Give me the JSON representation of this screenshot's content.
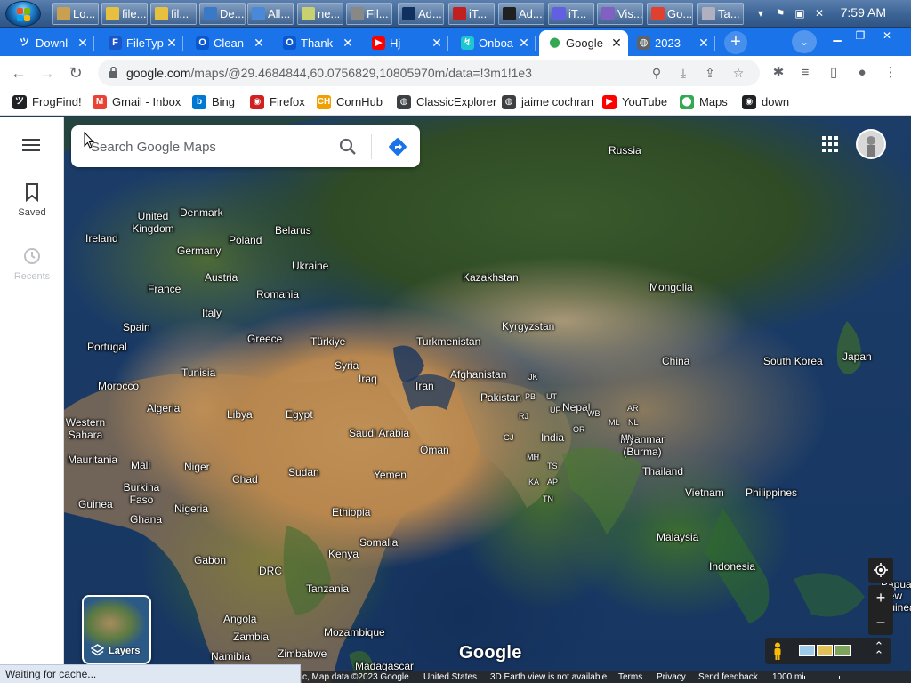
{
  "taskbar": {
    "tasks": [
      {
        "label": "Lo...",
        "color": "#c8a050"
      },
      {
        "label": "file...",
        "color": "#e8c040"
      },
      {
        "label": "fil...",
        "color": "#e8c040"
      },
      {
        "label": "De...",
        "color": "#3a78c8"
      },
      {
        "label": "All...",
        "color": "#4a88d8"
      },
      {
        "label": "ne...",
        "color": "#c8d070"
      },
      {
        "label": "Fil...",
        "color": "#888888"
      },
      {
        "label": "Ad...",
        "color": "#103060"
      },
      {
        "label": "iT...",
        "color": "#c02020"
      },
      {
        "label": "Ad...",
        "color": "#202020"
      },
      {
        "label": "iT...",
        "color": "#6060e0"
      },
      {
        "label": "Vis...",
        "color": "#8060c0"
      },
      {
        "label": "Go...",
        "color": "#e04030"
      },
      {
        "label": "Ta...",
        "color": "#b0b0c0"
      }
    ],
    "clock": "7:59 AM"
  },
  "browser": {
    "tabs": [
      {
        "label": "Downl",
        "icon": "frogfind-icon",
        "color": "#1a73e8",
        "active": false
      },
      {
        "label": "FileTyp",
        "icon": "filetype-icon",
        "color": "#1a56c8",
        "active": false
      },
      {
        "label": "Clean",
        "icon": "clean-icon",
        "color": "#0b57d0",
        "active": false
      },
      {
        "label": "Thank",
        "icon": "thank-icon",
        "color": "#0b57d0",
        "active": false
      },
      {
        "label": "Hj",
        "icon": "youtube-icon",
        "color": "#ff0000",
        "active": false
      },
      {
        "label": "Onboa",
        "icon": "onboard-icon",
        "color": "#1cc7d0",
        "active": false
      },
      {
        "label": "Google",
        "icon": "maps-pin-icon",
        "color": "#34a853",
        "active": true
      },
      {
        "label": "2023",
        "icon": "globe-icon",
        "color": "#5f6368",
        "active": false
      }
    ],
    "url_host": "google.com",
    "url_path": "/maps/@29.4684844,60.0756829,10805970m/data=!3m1!1e3"
  },
  "bookmarks": [
    {
      "label": "FrogFind!",
      "color": "#202124",
      "icon": "frogfind-icon"
    },
    {
      "label": "Gmail - Inbox",
      "color": "#ea4335",
      "icon": "gmail-icon"
    },
    {
      "label": "Bing",
      "color": "#0078d4",
      "icon": "bing-icon"
    },
    {
      "label": "Firefox",
      "color": "#d02020",
      "icon": "firefox-icon"
    },
    {
      "label": "CornHub",
      "color": "#f0a000",
      "icon": "cornhub-icon"
    },
    {
      "label": "ClassicExplorer",
      "color": "#3c4043",
      "icon": "globe-icon"
    },
    {
      "label": "jaime cochran",
      "color": "#3c4043",
      "icon": "globe-icon"
    },
    {
      "label": "YouTube",
      "color": "#ff0000",
      "icon": "youtube-icon"
    },
    {
      "label": "Maps",
      "color": "#34a853",
      "icon": "maps-pin-icon"
    },
    {
      "label": "down",
      "color": "#202124",
      "icon": "github-icon"
    }
  ],
  "maps": {
    "rail": {
      "saved": "Saved",
      "recents": "Recents"
    },
    "search_placeholder": "Search Google Maps",
    "layers_label": "Layers",
    "logo": "Google",
    "labels": [
      "Russia",
      "United Kingdom",
      "Denmark",
      "Belarus",
      "Ireland",
      "Poland",
      "Germany",
      "Ukraine",
      "Kazakhstan",
      "Mongolia",
      "France",
      "Austria",
      "Romania",
      "Italy",
      "Spain",
      "Greece",
      "Türkiye",
      "Turkmenistan",
      "Kyrgyzstan",
      "Portugal",
      "Syria",
      "Tunisia",
      "Iraq",
      "Afghanistan",
      "China",
      "South Korea",
      "Japan",
      "Morocco",
      "Iran",
      "Pakistan",
      "Algeria",
      "Libya",
      "Egypt",
      "Nepal",
      "Western Sahara",
      "Saudi Arabia",
      "India",
      "Myanmar (Burma)",
      "Mauritania",
      "Mali",
      "Oman",
      "Niger",
      "Sudan",
      "Thailand",
      "Yemen",
      "Chad",
      "Burkina Faso",
      "Guinea",
      "Nigeria",
      "Vietnam",
      "Philippines",
      "Ghana",
      "Ethiopia",
      "Somalia",
      "Malaysia",
      "Gabon",
      "Kenya",
      "DRC",
      "Indonesia",
      "Tanzania",
      "Angola",
      "Mozambique",
      "Zambia",
      "Zimbabwe",
      "Namibia",
      "Madagascar",
      "Papua New Guinea",
      "JK",
      "PB",
      "UT",
      "UP",
      "RJ",
      "GJ",
      "MP",
      "MH",
      "TS",
      "KA",
      "AP",
      "TN",
      "WB",
      "OR",
      "ML",
      "NL",
      "MN",
      "AR"
    ],
    "footer": {
      "data": "c, Map data ©2023 Google",
      "country": "United States",
      "earth": "3D Earth view is not available",
      "terms": "Terms",
      "privacy": "Privacy",
      "feedback": "Send feedback",
      "scale": "1000 mi"
    }
  },
  "status": "Waiting for cache..."
}
